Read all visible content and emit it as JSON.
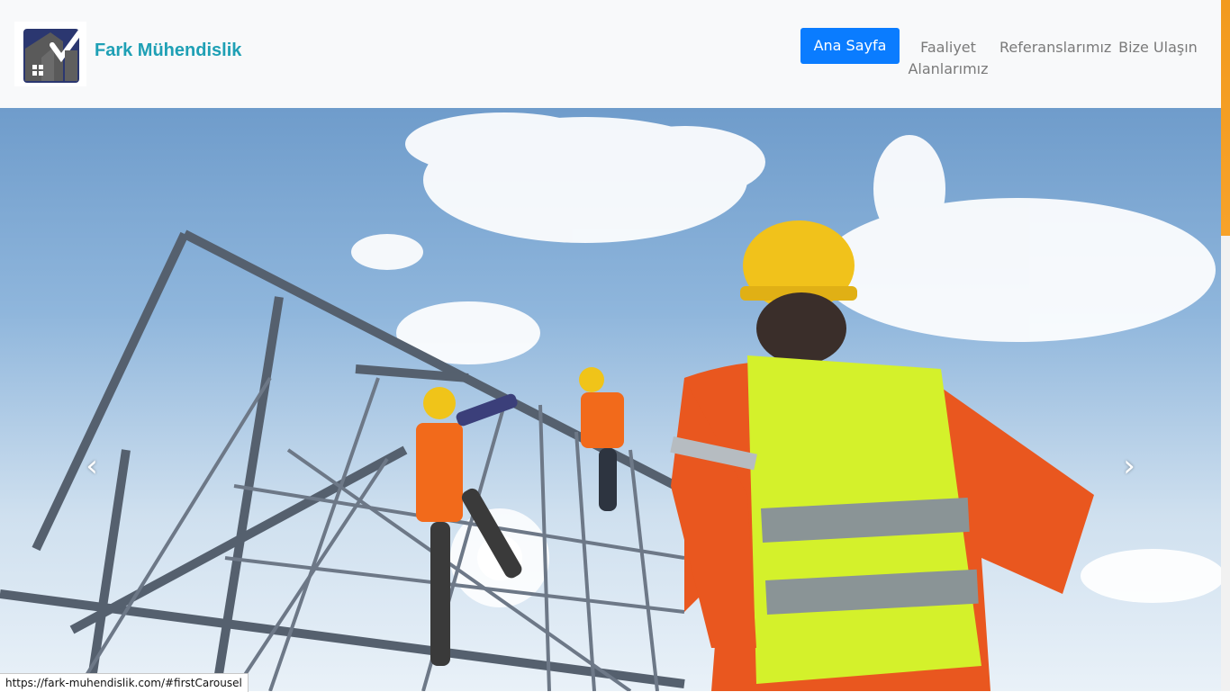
{
  "brand": {
    "name": "Fark Mühendislik"
  },
  "nav": {
    "active": "Ana Sayfa",
    "items": [
      {
        "label_line1": "Faaliyet",
        "label_line2": "Alanlarımız"
      },
      {
        "label_line1": "Referanslarımız"
      },
      {
        "label_line1": "Bize Ulaşın"
      }
    ]
  },
  "carousel": {
    "prev_icon": "chevron-left-icon",
    "next_icon": "chevron-right-icon"
  },
  "status_bar": {
    "url": "https://fark-muhendislik.com/#firstCarousel"
  },
  "colors": {
    "brand_text": "#1fa0b5",
    "active_button": "#0a7cff",
    "nav_text": "#7a7a7a",
    "navbar_bg": "#f8f9fa",
    "scroll_thumb": "#f29a1e"
  }
}
